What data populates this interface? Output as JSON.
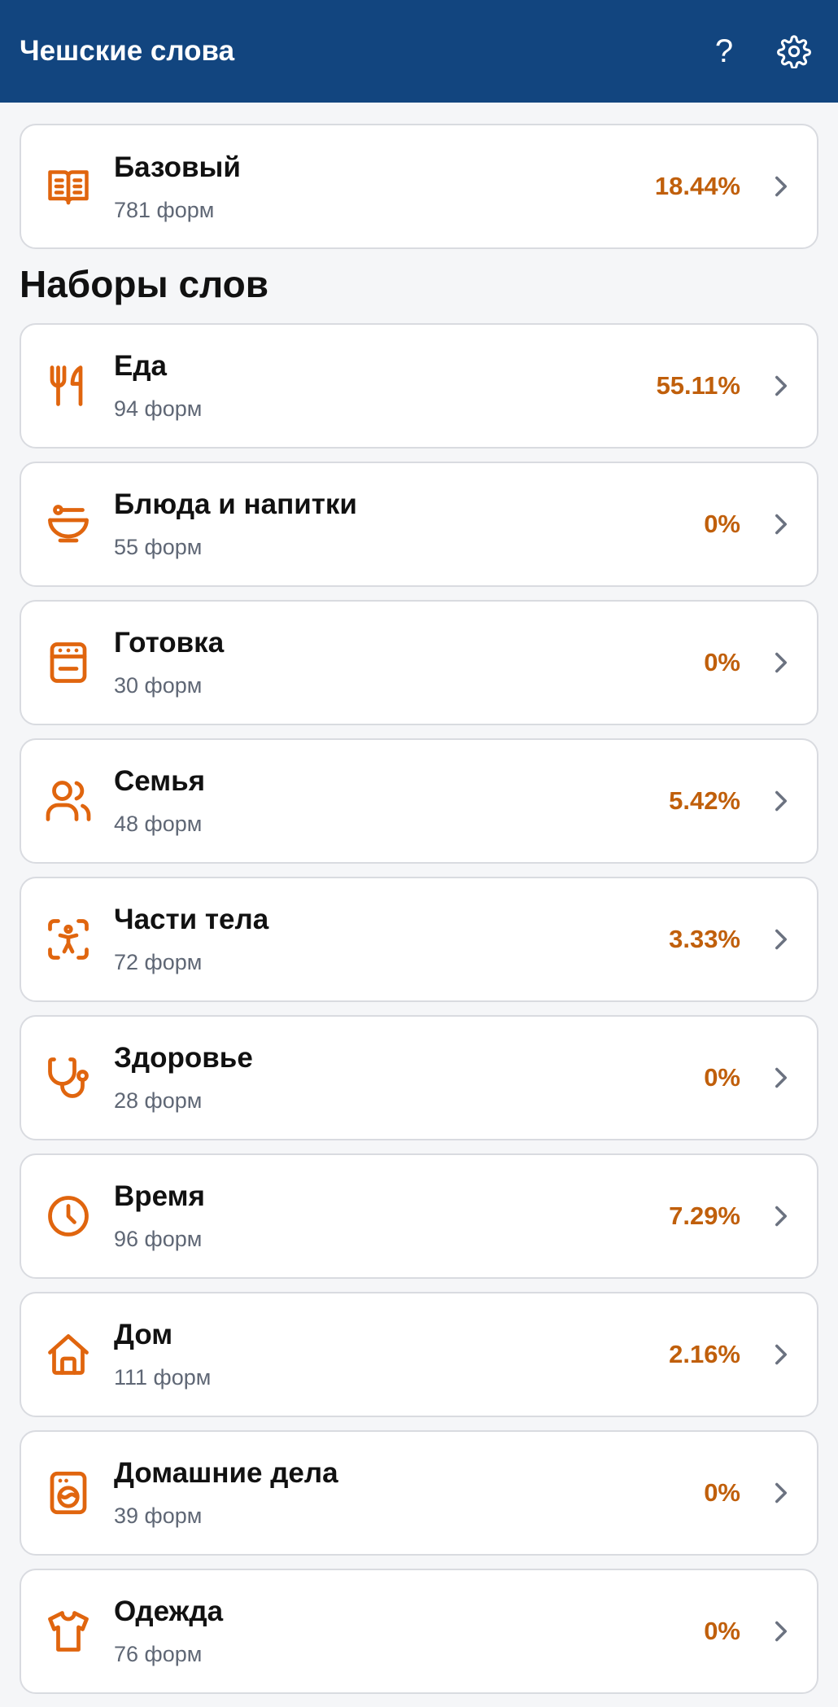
{
  "header": {
    "title": "Чешские слова",
    "help_label": "?"
  },
  "base_card": {
    "title": "Базовый",
    "subtitle": "781 форм",
    "percent": "18.44%",
    "icon": "book-open-icon"
  },
  "section": {
    "title": "Наборы слов"
  },
  "sets": [
    {
      "title": "Еда",
      "subtitle": "94 форм",
      "percent": "55.11%",
      "icon": "utensils-icon"
    },
    {
      "title": "Блюда и напитки",
      "subtitle": "55 форм",
      "percent": "0%",
      "icon": "bowl-icon"
    },
    {
      "title": "Готовка",
      "subtitle": "30 форм",
      "percent": "0%",
      "icon": "stove-icon"
    },
    {
      "title": "Семья",
      "subtitle": "48 форм",
      "percent": "5.42%",
      "icon": "users-icon"
    },
    {
      "title": "Части тела",
      "subtitle": "72 форм",
      "percent": "3.33%",
      "icon": "body-scan-icon"
    },
    {
      "title": "Здоровье",
      "subtitle": "28 форм",
      "percent": "0%",
      "icon": "stethoscope-icon"
    },
    {
      "title": "Время",
      "subtitle": "96 форм",
      "percent": "7.29%",
      "icon": "clock-icon"
    },
    {
      "title": "Дом",
      "subtitle": "111 форм",
      "percent": "2.16%",
      "icon": "house-icon"
    },
    {
      "title": "Домашние дела",
      "subtitle": "39 форм",
      "percent": "0%",
      "icon": "washing-machine-icon"
    },
    {
      "title": "Одежда",
      "subtitle": "76 форм",
      "percent": "0%",
      "icon": "shirt-icon"
    }
  ],
  "colors": {
    "header_bg": "#12457f",
    "accent": "#c05f0b",
    "icon": "#e0650e",
    "background": "#f5f6f8"
  }
}
